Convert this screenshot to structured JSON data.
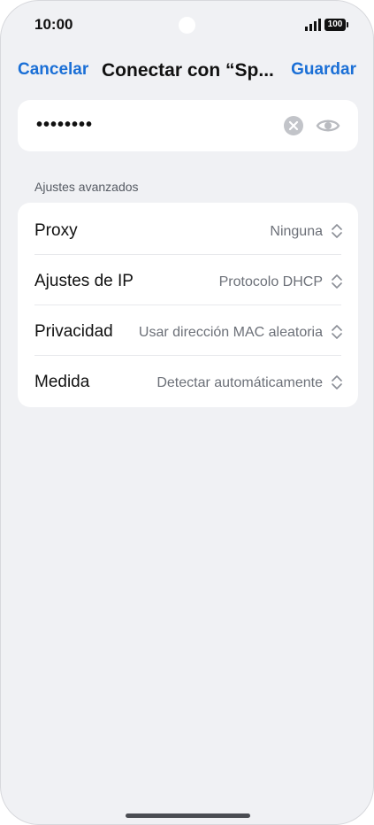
{
  "status_bar": {
    "time": "10:00",
    "battery": "100",
    "icons": [
      "signal-icon",
      "battery-icon"
    ]
  },
  "nav": {
    "cancel_label": "Cancelar",
    "title": "Conectar con “Sp...",
    "save_label": "Guardar"
  },
  "password": {
    "value": "••••••••",
    "icons": [
      "clear-icon",
      "eye-icon"
    ]
  },
  "advanced": {
    "section_label": "Ajustes avanzados",
    "rows": [
      {
        "label": "Proxy",
        "value": "Ninguna"
      },
      {
        "label": "Ajustes de IP",
        "value": "Protocolo DHCP"
      },
      {
        "label": "Privacidad",
        "value": "Usar dirección MAC aleatoria"
      },
      {
        "label": "Medida",
        "value": "Detectar automáticamente"
      }
    ],
    "row_icon": "chevron-up-down-icon"
  },
  "colors": {
    "accent": "#1a6fd6",
    "background": "#f0f1f4",
    "card": "#ffffff"
  }
}
